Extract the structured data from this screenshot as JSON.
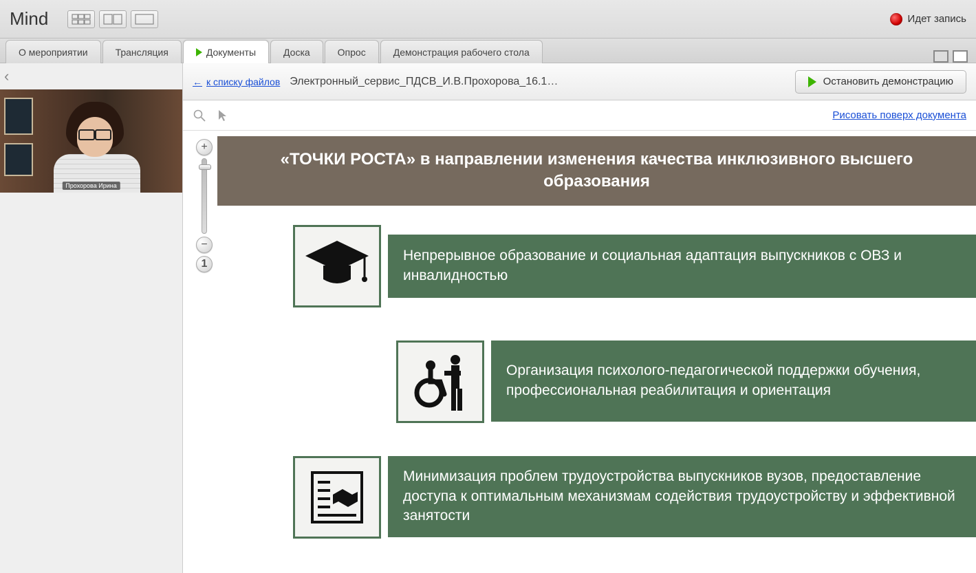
{
  "app": {
    "name": "Mind"
  },
  "recording": {
    "label": "Идет запись"
  },
  "tabs": {
    "about": "О мероприятии",
    "stream": "Трансляция",
    "docs": "Документы",
    "board": "Доска",
    "poll": "Опрос",
    "screenshare": "Демонстрация рабочего стола"
  },
  "presenter": {
    "name": "Прохорова Ирина"
  },
  "doc": {
    "back_link": "к списку файлов",
    "title": "Электронный_сервис_ПДСВ_И.В.Прохорова_16.1…",
    "stop_button": "Остановить демонстрацию",
    "draw_link": "Рисовать поверх документа"
  },
  "slide": {
    "title": "«ТОЧКИ РОСТА» в направлении изменения качества инклюзивного высшего образования",
    "rows": [
      "Непрерывное образование и социальная адаптация выпускников с ОВЗ и инвалидностью",
      "Организация психолого-педагогической поддержки обучения, профессиональная реабилитация и ориентация",
      "Минимизация проблем трудоустройства выпускников вузов, предоставление доступа к оптимальным механизмам содействия трудоустройству и эффективной занятости"
    ]
  },
  "zoom": {
    "reset_label": "1"
  }
}
